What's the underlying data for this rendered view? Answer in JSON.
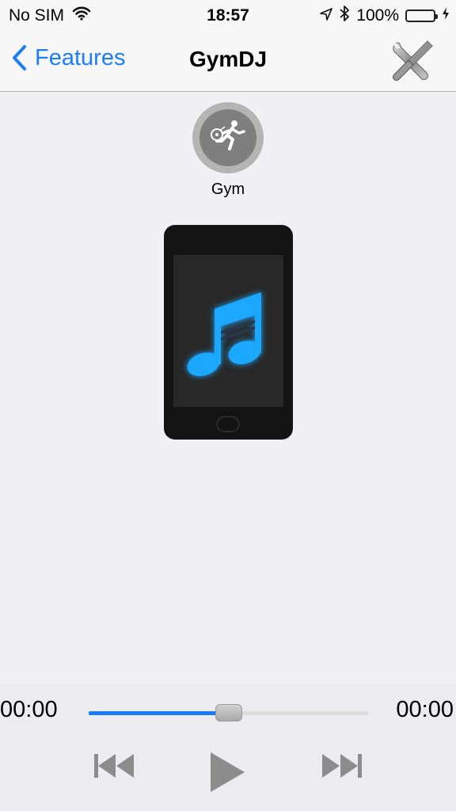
{
  "status_bar": {
    "carrier": "No SIM",
    "time": "18:57",
    "battery": "100%"
  },
  "nav": {
    "back_label": "Features",
    "title": "GymDJ"
  },
  "profile": {
    "label": "Gym"
  },
  "player": {
    "current_time": "00:00",
    "total_time": "00:00",
    "progress": 0.5
  },
  "icons": {
    "wifi": "wifi-icon",
    "location": "location-icon",
    "bluetooth": "bluetooth-icon",
    "battery": "battery-icon",
    "charging": "charging-icon",
    "back": "chevron-left-icon",
    "tools": "tools-icon",
    "profile": "runner-music-icon",
    "device": "music-note-icon",
    "prev": "rewind-icon",
    "play": "play-icon",
    "next": "fast-forward-icon"
  },
  "colors": {
    "accent": "#1a7ef7",
    "note_glow": "#1aa8ff",
    "battery_fill": "#4cd964"
  }
}
